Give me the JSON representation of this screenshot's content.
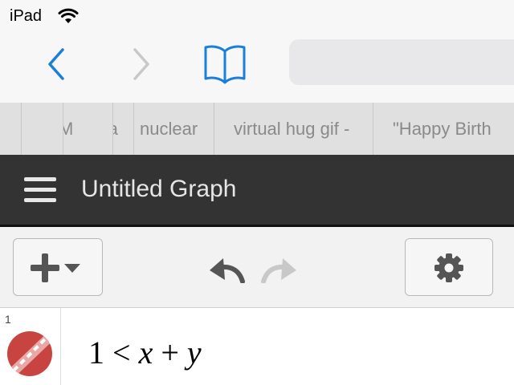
{
  "status_bar": {
    "carrier": "iPad"
  },
  "browser": {
    "tabs": [
      {
        "label": ""
      },
      {
        "label": "M"
      },
      {
        "label": "Ba"
      },
      {
        "label": "nuclear"
      },
      {
        "label": "virtual hug gif -"
      },
      {
        "label": "\"Happy Birth"
      }
    ]
  },
  "app": {
    "title": "Untitled Graph"
  },
  "expressions": [
    {
      "index": "1",
      "parts": [
        "1",
        "<",
        "x",
        "+",
        "y"
      ],
      "color": "#c74440"
    }
  ],
  "colors": {
    "ios_blue": "#1a7fdb",
    "header_bg": "#333333",
    "disabled_gray": "#c8c8c8"
  },
  "icons": [
    "back-chevron-icon",
    "forward-chevron-icon",
    "bookmarks-book-icon",
    "wifi-icon",
    "hamburger-menu-icon",
    "plus-icon",
    "caret-down-icon",
    "undo-icon",
    "redo-icon",
    "gear-icon",
    "graph-color-icon"
  ]
}
